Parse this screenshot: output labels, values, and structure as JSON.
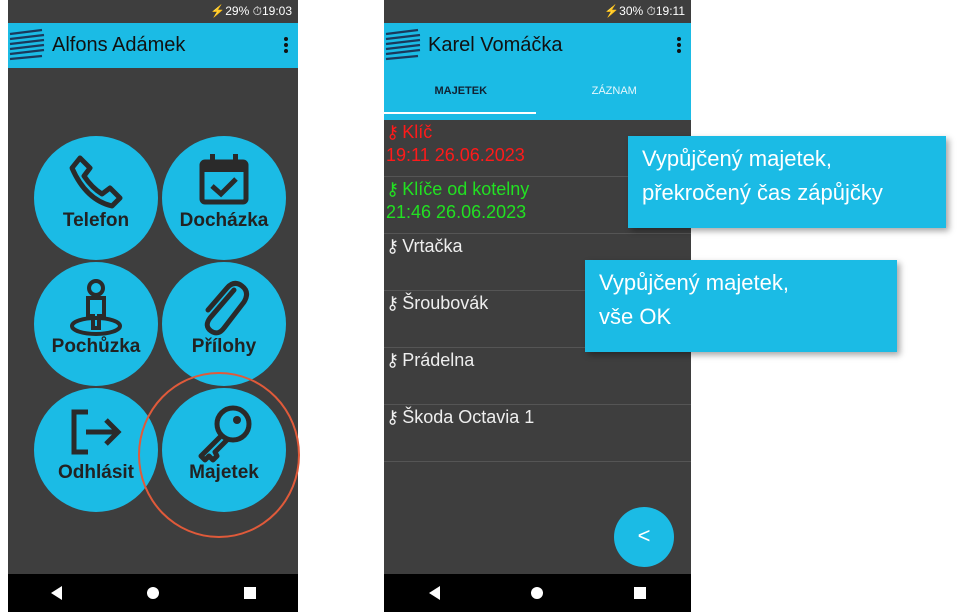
{
  "phone1": {
    "status": "⚡29% ⏱19:03",
    "title": "Alfons Adámek",
    "tiles": [
      {
        "label": "Telefon",
        "icon": "phone-icon"
      },
      {
        "label": "Docházka",
        "icon": "calendar-check-icon"
      },
      {
        "label": "Pochůzka",
        "icon": "person-pin-icon"
      },
      {
        "label": "Přílohy",
        "icon": "paperclip-icon"
      },
      {
        "label": "Odhlásit",
        "icon": "logout-icon"
      },
      {
        "label": "Majetek",
        "icon": "key-icon"
      }
    ]
  },
  "phone2": {
    "status": "⚡30% ⏱19:11",
    "title": "Karel Vomáčka",
    "tabs": [
      "MAJETEK",
      "ZÁZNAM"
    ],
    "assets": [
      {
        "name": "Klíč",
        "time": "19:11 26.06.2023",
        "state": "overdue"
      },
      {
        "name": "Klíče od kotelny",
        "time": "21:46 26.06.2023",
        "state": "ok"
      },
      {
        "name": "Vrtačka",
        "time": "",
        "state": "available"
      },
      {
        "name": "Šroubovák",
        "time": "",
        "state": "available"
      },
      {
        "name": "Prádelna",
        "time": "",
        "state": "available"
      },
      {
        "name": "Škoda Octavia 1",
        "time": "",
        "state": "available"
      }
    ],
    "fab": "<"
  },
  "callouts": {
    "overdue_line1": "Vypůjčený majetek,",
    "overdue_line2": "překročený čas zápůjčky",
    "ok_line1": "Vypůjčený majetek,",
    "ok_line2": "vše OK"
  },
  "colors": {
    "accent": "#1bbbe5",
    "background": "#3e3e3e",
    "overdue": "#ff1a1a",
    "ok": "#22e022",
    "highlight_ring": "#e05a3a"
  }
}
